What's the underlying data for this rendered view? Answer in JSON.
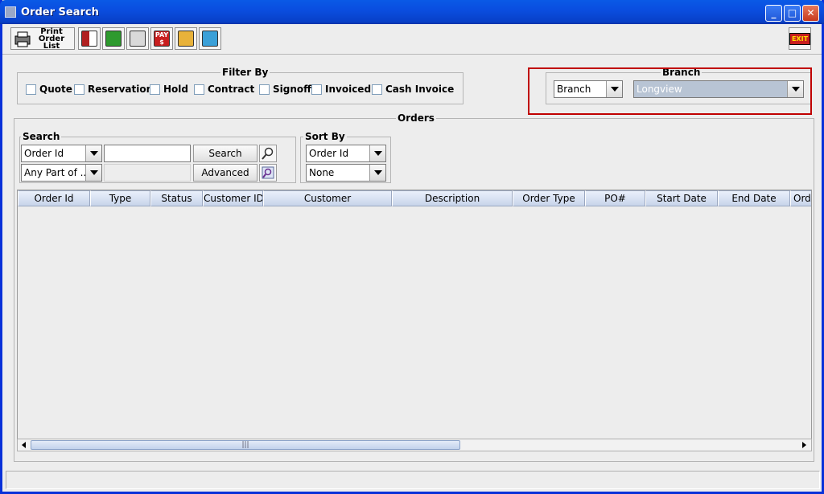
{
  "window": {
    "title": "Order Search",
    "controls": [
      "minimize",
      "maximize",
      "close"
    ]
  },
  "toolbar": {
    "print_order_list_label": [
      "Print",
      "Order List"
    ],
    "icons": [
      "print-icon",
      "truck-icon",
      "checklist-icon",
      "cash-register-icon",
      "pay-icon",
      "card-icon",
      "refresh-icon"
    ],
    "exit_label": "EXIT"
  },
  "filter_by": {
    "title": "Filter By",
    "options": [
      "Quote",
      "Reservation",
      "Hold",
      "Contract",
      "Signoff",
      "Invoiced",
      "Cash Invoice"
    ]
  },
  "branch": {
    "title": "Branch",
    "type_select": "Branch",
    "value_select": "Longview"
  },
  "orders": {
    "title": "Orders",
    "search": {
      "title": "Search",
      "field_select": "Order Id",
      "match_select": "Any Part of ...",
      "search_value": "",
      "search_button": "Search",
      "advanced_button": "Advanced"
    },
    "sort_by": {
      "title": "Sort By",
      "primary": "Order Id",
      "secondary": "None"
    },
    "columns": [
      "Order Id",
      "Type",
      "Status",
      "Customer ID",
      "Customer",
      "Description",
      "Order Type",
      "PO#",
      "Start Date",
      "End Date",
      "Ord"
    ],
    "rows": [],
    "scroll_thumb": "|||"
  },
  "colors": {
    "title_bar": "#0a4ee0",
    "highlight": "#c00000",
    "header_bg": "#c7d4ea"
  }
}
